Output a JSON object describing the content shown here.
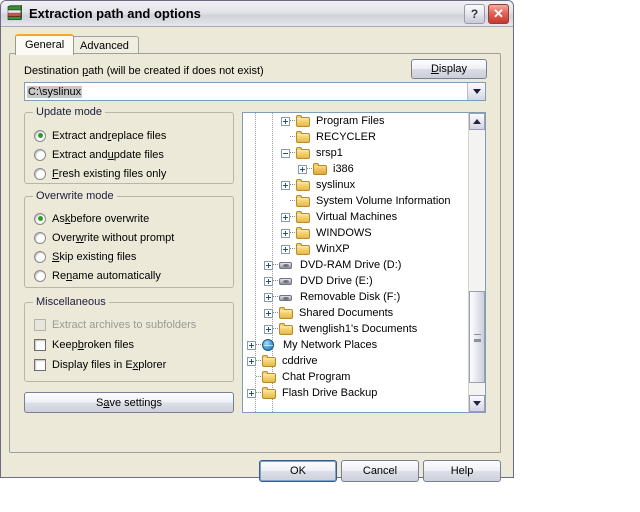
{
  "window": {
    "title": "Extraction path and options",
    "icon": "winrar-books-icon",
    "help_button": "?",
    "close_button": "✕"
  },
  "tabs": [
    {
      "label": "General",
      "active": true
    },
    {
      "label": "Advanced",
      "active": false
    }
  ],
  "destination": {
    "label_pre": "Destination ",
    "label_accel": "p",
    "label_post": "ath (will be created if does not exist)",
    "value": "C:\\syslinux",
    "display_button_pre": "",
    "display_button_accel": "D",
    "display_button_post": "isplay",
    "dropdown_icon": "chevron-down-icon"
  },
  "update_mode": {
    "legend": "Update mode",
    "options": [
      {
        "pre": "Extract and ",
        "accel": "r",
        "post": "eplace files",
        "checked": true
      },
      {
        "pre": "Extract and ",
        "accel": "u",
        "post": "pdate files",
        "checked": false
      },
      {
        "pre": "",
        "accel": "F",
        "post": "resh existing files only",
        "checked": false
      }
    ]
  },
  "overwrite_mode": {
    "legend": "Overwrite mode",
    "options": [
      {
        "pre": "As",
        "accel": "k",
        "post": " before overwrite",
        "checked": true
      },
      {
        "pre": "Over",
        "accel": "w",
        "post": "rite without prompt",
        "checked": false
      },
      {
        "pre": "",
        "accel": "S",
        "post": "kip existing files",
        "checked": false
      },
      {
        "pre": "Re",
        "accel": "n",
        "post": "ame automatically",
        "checked": false
      }
    ]
  },
  "miscellaneous": {
    "legend": "Miscellaneous",
    "options": [
      {
        "pre": "Extract archives to subfolders",
        "accel": "",
        "post": "",
        "checked": false,
        "disabled": true
      },
      {
        "pre": "Keep ",
        "accel": "b",
        "post": "roken files",
        "checked": false,
        "disabled": false
      },
      {
        "pre": "Display files in E",
        "accel": "x",
        "post": "plorer",
        "checked": false,
        "disabled": false
      }
    ]
  },
  "save_settings": {
    "pre": "S",
    "accel": "a",
    "post": "ve settings"
  },
  "tree": {
    "items": [
      {
        "label": "Program Files",
        "depth": 2,
        "icon": "folder-icon",
        "expander": "plus"
      },
      {
        "label": "RECYCLER",
        "depth": 2,
        "icon": "folder-icon",
        "expander": "none"
      },
      {
        "label": "srsp1",
        "depth": 2,
        "icon": "folder-icon",
        "expander": "minus"
      },
      {
        "label": "i386",
        "depth": 3,
        "icon": "folder-open-icon",
        "expander": "plus"
      },
      {
        "label": "syslinux",
        "depth": 2,
        "icon": "folder-icon",
        "expander": "plus"
      },
      {
        "label": "System Volume Information",
        "depth": 2,
        "icon": "folder-icon",
        "expander": "none"
      },
      {
        "label": "Virtual Machines",
        "depth": 2,
        "icon": "folder-icon",
        "expander": "plus"
      },
      {
        "label": "WINDOWS",
        "depth": 2,
        "icon": "folder-icon",
        "expander": "plus"
      },
      {
        "label": "WinXP",
        "depth": 2,
        "icon": "folder-icon",
        "expander": "plus"
      },
      {
        "label": "DVD-RAM Drive (D:)",
        "depth": 1,
        "icon": "optical-drive-icon",
        "expander": "plus"
      },
      {
        "label": "DVD Drive (E:)",
        "depth": 1,
        "icon": "optical-drive-icon",
        "expander": "plus"
      },
      {
        "label": "Removable Disk (F:)",
        "depth": 1,
        "icon": "removable-disk-icon",
        "expander": "plus"
      },
      {
        "label": "Shared Documents",
        "depth": 1,
        "icon": "folder-icon",
        "expander": "plus"
      },
      {
        "label": "twenglish1's Documents",
        "depth": 1,
        "icon": "folder-icon",
        "expander": "plus"
      },
      {
        "label": "My Network Places",
        "depth": 0,
        "icon": "network-globe-icon",
        "expander": "plus"
      },
      {
        "label": "cddrive",
        "depth": 0,
        "icon": "folder-icon",
        "expander": "plus"
      },
      {
        "label": "Chat Program",
        "depth": 0,
        "icon": "folder-icon",
        "expander": "none"
      },
      {
        "label": "Flash Drive Backup",
        "depth": 0,
        "icon": "folder-icon",
        "expander": "plus"
      }
    ],
    "scrollbar": {
      "up_icon": "scroll-up-icon",
      "down_icon": "scroll-down-icon"
    }
  },
  "buttons": {
    "ok": "OK",
    "cancel": "Cancel",
    "help": "Help"
  },
  "colors": {
    "dialog_face": "#ece9d8",
    "radio_dot_green": "#2e9b24",
    "active_tab_accent": "#f0a830",
    "folder_yellow": "#f5d173",
    "close_button_red": "#c8372c",
    "field_border_blue": "#7f9db9"
  }
}
